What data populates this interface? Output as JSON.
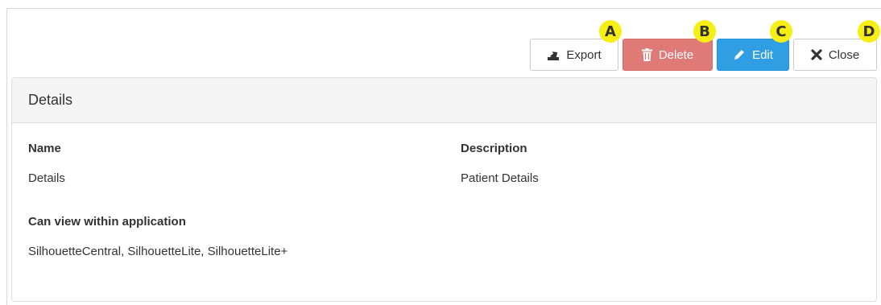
{
  "toolbar": {
    "export": {
      "label": "Export",
      "badge": "A",
      "icon": "export-icon"
    },
    "delete": {
      "label": "Delete",
      "badge": "B",
      "icon": "trash-icon"
    },
    "edit": {
      "label": "Edit",
      "badge": "C",
      "icon": "pencil-icon"
    },
    "close": {
      "label": "Close",
      "badge": "D",
      "icon": "close-icon"
    }
  },
  "panel": {
    "title": "Details",
    "fields": {
      "name": {
        "label": "Name",
        "value": "Details"
      },
      "description": {
        "label": "Description",
        "value": "Patient Details"
      },
      "can_view": {
        "label": "Can view within application",
        "value": "SilhouetteCentral, SilhouetteLite, SilhouetteLite+"
      }
    }
  },
  "colors": {
    "delete": "#df7a77",
    "edit": "#2f9ee3",
    "badge": "#f7ee14",
    "heading_bg": "#f5f5f5"
  }
}
